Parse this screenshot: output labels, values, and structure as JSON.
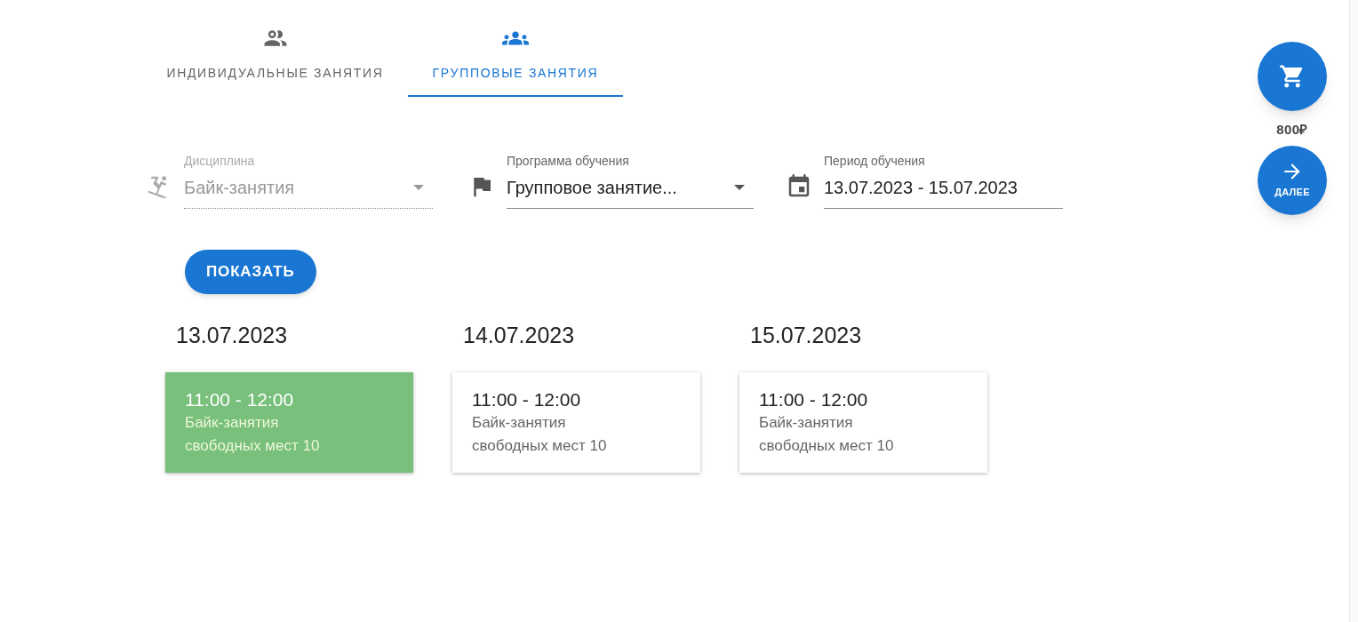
{
  "tabs": [
    {
      "label": "ИНДИВИДУАЛЬНЫЕ ЗАНЯТИЯ",
      "selected": false
    },
    {
      "label": "ГРУППОВЫЕ ЗАНЯТИЯ",
      "selected": true
    }
  ],
  "filters": [
    {
      "kind": "select",
      "label": "Дисциплина",
      "value": "Байк-занятия",
      "disabled": true
    },
    {
      "kind": "select",
      "label": "Программа обучения",
      "value": "Групповое занятие...",
      "disabled": false
    },
    {
      "kind": "date",
      "label": "Период обучения",
      "value": "13.07.2023 - 15.07.2023",
      "disabled": false
    }
  ],
  "show_button": "ПОКАЗАТЬ",
  "days": [
    {
      "date": "13.07.2023",
      "slots": [
        {
          "time": "11:00 - 12:00",
          "discipline": "Байк-занятия",
          "seats": "свободных мест 10",
          "selected": true
        }
      ]
    },
    {
      "date": "14.07.2023",
      "slots": [
        {
          "time": "11:00 - 12:00",
          "discipline": "Байк-занятия",
          "seats": "свободных мест 10",
          "selected": false
        }
      ]
    },
    {
      "date": "15.07.2023",
      "slots": [
        {
          "time": "11:00 - 12:00",
          "discipline": "Байк-занятия",
          "seats": "свободных мест 10",
          "selected": false
        }
      ]
    }
  ],
  "cart": {
    "total": "800₽"
  },
  "next_button": "ДАЛЕЕ"
}
